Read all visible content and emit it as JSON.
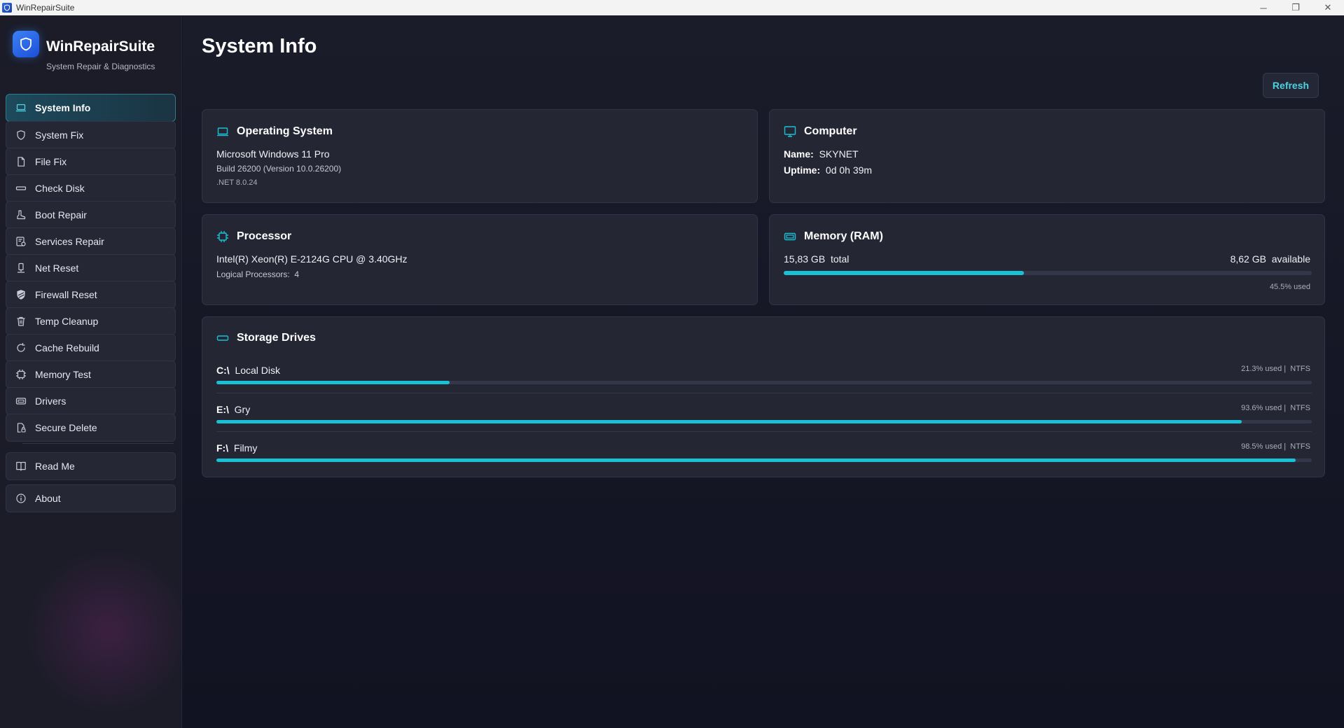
{
  "window": {
    "title": "WinRepairSuite",
    "controls": {
      "minimize": "─",
      "restore": "❐",
      "close": "✕"
    }
  },
  "brand": {
    "name": "WinRepairSuite",
    "subtitle": "System Repair & Diagnostics",
    "icon": "shield-icon",
    "accent": "#2f6fe0"
  },
  "sidebar": {
    "items": [
      {
        "label": "System Info",
        "icon": "laptop-icon",
        "active": true
      },
      {
        "label": "System Fix",
        "icon": "shield-icon"
      },
      {
        "label": "File Fix",
        "icon": "file-icon"
      },
      {
        "label": "Check Disk",
        "icon": "disk-icon"
      },
      {
        "label": "Boot Repair",
        "icon": "boot-icon"
      },
      {
        "label": "Services Repair",
        "icon": "services-icon"
      },
      {
        "label": "Net Reset",
        "icon": "network-icon"
      },
      {
        "label": "Firewall Reset",
        "icon": "firewall-icon"
      },
      {
        "label": "Temp Cleanup",
        "icon": "trash-icon"
      },
      {
        "label": "Cache Rebuild",
        "icon": "refresh-icon"
      },
      {
        "label": "Memory Test",
        "icon": "chip-icon"
      },
      {
        "label": "Drivers",
        "icon": "driver-icon"
      },
      {
        "label": "Secure Delete",
        "icon": "secure-delete-icon"
      }
    ],
    "footer_items": [
      {
        "label": "Read Me",
        "icon": "book-icon"
      },
      {
        "label": "About",
        "icon": "info-icon"
      }
    ]
  },
  "main": {
    "title": "System Info",
    "refresh_label": "Refresh",
    "accent": "#19c1d6",
    "os": {
      "title": "Operating System",
      "name": "Microsoft Windows 11 Pro",
      "build": "Build 26200 (Version 10.0.26200)",
      "dotnet": ".NET 8.0.24"
    },
    "computer": {
      "title": "Computer",
      "name_label": "Name:",
      "name_value": "SKYNET",
      "uptime_label": "Uptime:",
      "uptime_value": "0d 0h 39m"
    },
    "processor": {
      "title": "Processor",
      "name": "Intel(R) Xeon(R) E-2124G CPU @ 3.40GHz",
      "logical_label": "Logical Processors:",
      "logical_value": "4"
    },
    "memory": {
      "title": "Memory (RAM)",
      "total_value": "15,83 GB",
      "total_label": "total",
      "available_value": "8,62 GB",
      "available_label": "available",
      "used_text": "45.5%  used",
      "used_fraction": 0.455
    },
    "storage": {
      "title": "Storage Drives",
      "drives": [
        {
          "letter": "C:\\",
          "name": "Local Disk",
          "used_text": "21.3%  used  |",
          "fs": "NTFS",
          "used_fraction": 0.213
        },
        {
          "letter": "E:\\",
          "name": "Gry",
          "used_text": "93.6%  used  |",
          "fs": "NTFS",
          "used_fraction": 0.936
        },
        {
          "letter": "F:\\",
          "name": "Filmy",
          "used_text": "98.5%  used  |",
          "fs": "NTFS",
          "used_fraction": 0.985
        }
      ]
    }
  }
}
